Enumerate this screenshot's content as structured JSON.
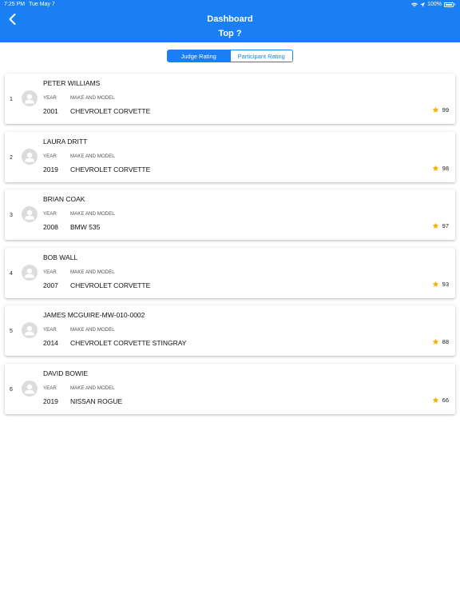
{
  "status_bar": {
    "time": "7:25 PM",
    "date": "Tue May 7",
    "battery": "100%"
  },
  "header": {
    "title": "Dashboard",
    "subtitle": "Top ?"
  },
  "tabs": {
    "judge": "Judge Rating",
    "participant": "Participant Rating",
    "active": "judge"
  },
  "labels": {
    "year": "YEAR",
    "make_model": "MAKE AND MODEL"
  },
  "colors": {
    "primary": "#1a7ff5",
    "star": "#f5b400",
    "avatar_bg": "#dcdcdc"
  },
  "entries": [
    {
      "rank": "1",
      "name": "PETER WILLIAMS",
      "year": "2001",
      "make_model": "CHEVROLET CORVETTE",
      "rating": "99"
    },
    {
      "rank": "2",
      "name": "LAURA DRITT",
      "year": "2019",
      "make_model": "CHEVROLET CORVETTE",
      "rating": "98"
    },
    {
      "rank": "3",
      "name": "BRIAN COAK",
      "year": "2008",
      "make_model": "BMW 535",
      "rating": "97"
    },
    {
      "rank": "4",
      "name": "BOB WALL",
      "year": "2007",
      "make_model": "CHEVROLET CORVETTE",
      "rating": "93"
    },
    {
      "rank": "5",
      "name": "JAMES MCGUIRE-MW-010-0002",
      "year": "2014",
      "make_model": "CHEVROLET CORVETTE STINGRAY",
      "rating": "88"
    },
    {
      "rank": "6",
      "name": "DAVID BOWIE",
      "year": "2019",
      "make_model": "NISSAN ROGUE",
      "rating": "66"
    }
  ]
}
